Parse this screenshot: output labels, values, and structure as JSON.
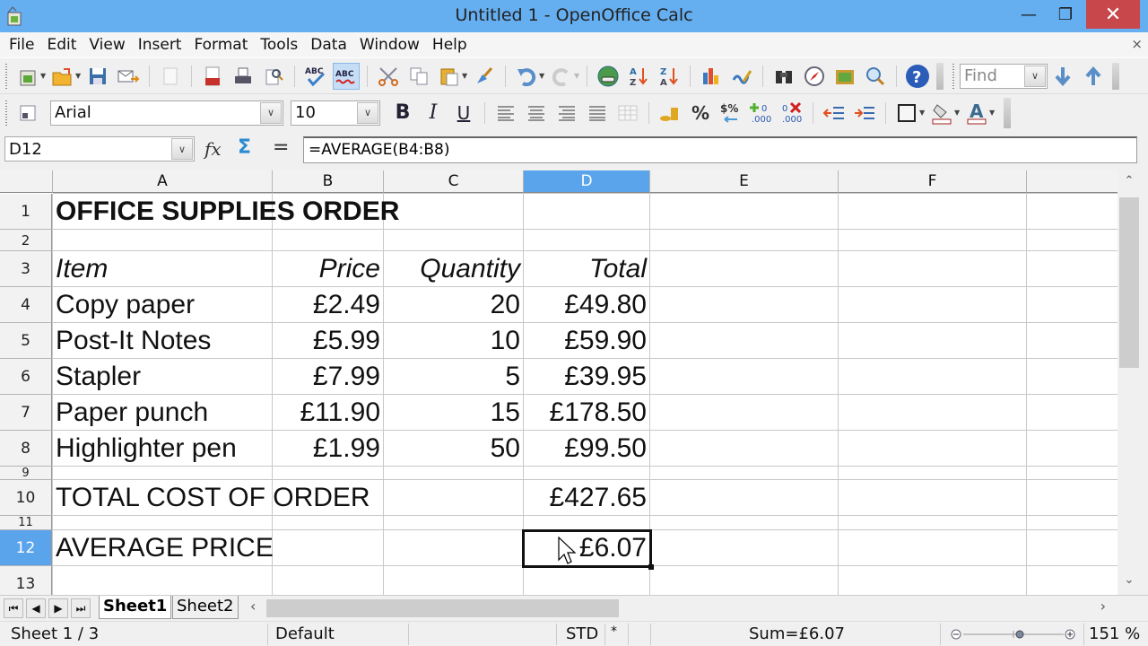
{
  "window": {
    "title": "Untitled 1 - OpenOffice Calc",
    "minimize_icon": "minimize-icon",
    "maximize_icon": "restore-icon",
    "close_icon": "close-icon"
  },
  "menu": {
    "items": [
      "File",
      "Edit",
      "View",
      "Insert",
      "Format",
      "Tools",
      "Data",
      "Window",
      "Help"
    ],
    "close_doc": "×"
  },
  "standard_toolbar": {
    "icons": [
      "new-icon",
      "open-icon",
      "save-icon",
      "email-icon",
      "edit-file-icon",
      "export-pdf-icon",
      "print-icon",
      "page-preview-icon",
      "spellcheck-icon",
      "autospellcheck-icon",
      "cut-icon",
      "copy-icon",
      "paste-icon",
      "clone-formatting-icon",
      "undo-icon",
      "redo-icon",
      "hyperlink-icon",
      "sort-ascending-icon",
      "sort-descending-icon",
      "chart-icon",
      "draw-functions-icon",
      "find-replace-icon",
      "navigator-icon",
      "gallery-icon",
      "zoom-icon",
      "help-icon"
    ],
    "find_placeholder": "Find"
  },
  "formatting_toolbar": {
    "font_name": "Arial",
    "font_size": "10",
    "bold": "B",
    "italic": "I",
    "underline": "U",
    "icons": [
      "align-left-icon",
      "align-center-icon",
      "align-right-icon",
      "justify-icon",
      "merge-cells-icon",
      "currency-icon",
      "percent-icon",
      "standard-format-icon",
      "add-decimal-icon",
      "delete-decimal-icon",
      "decrease-indent-icon",
      "increase-indent-icon",
      "borders-icon",
      "background-color-icon",
      "font-color-icon"
    ]
  },
  "formula_bar": {
    "name_box": "D12",
    "formula": "=AVERAGE(B4:B8)"
  },
  "sheet": {
    "columns": [
      "A",
      "B",
      "C",
      "D",
      "E",
      "F"
    ],
    "selected_column": "D",
    "selected_row": "12",
    "rows": [
      "1",
      "2",
      "3",
      "4",
      "5",
      "6",
      "7",
      "8",
      "9",
      "10",
      "11",
      "12",
      "13"
    ],
    "title": "OFFICE SUPPLIES ORDER",
    "headers": {
      "item": "Item",
      "price": "Price",
      "quantity": "Quantity",
      "total": "Total"
    },
    "items": [
      {
        "item": "Copy paper",
        "price": "£2.49",
        "quantity": "20",
        "total": "£49.80"
      },
      {
        "item": "Post-It Notes",
        "price": "£5.99",
        "quantity": "10",
        "total": "£59.90"
      },
      {
        "item": "Stapler",
        "price": "£7.99",
        "quantity": "5",
        "total": "£39.95"
      },
      {
        "item": "Paper punch",
        "price": "£11.90",
        "quantity": "15",
        "total": "£178.50"
      },
      {
        "item": "Highlighter pen",
        "price": "£1.99",
        "quantity": "50",
        "total": "£99.50"
      }
    ],
    "total_label": "TOTAL COST OF ORDER",
    "total_value": "£427.65",
    "average_label": "AVERAGE PRICE",
    "average_value": "£6.07"
  },
  "tabs": {
    "sheets": [
      "Sheet1",
      "Sheet2"
    ],
    "active": "Sheet1"
  },
  "status": {
    "sheet_pos": "Sheet 1 / 3",
    "page_style": "Default",
    "mode": "STD",
    "modified": "*",
    "sum": "Sum=£6.07",
    "zoom": "151 %"
  }
}
